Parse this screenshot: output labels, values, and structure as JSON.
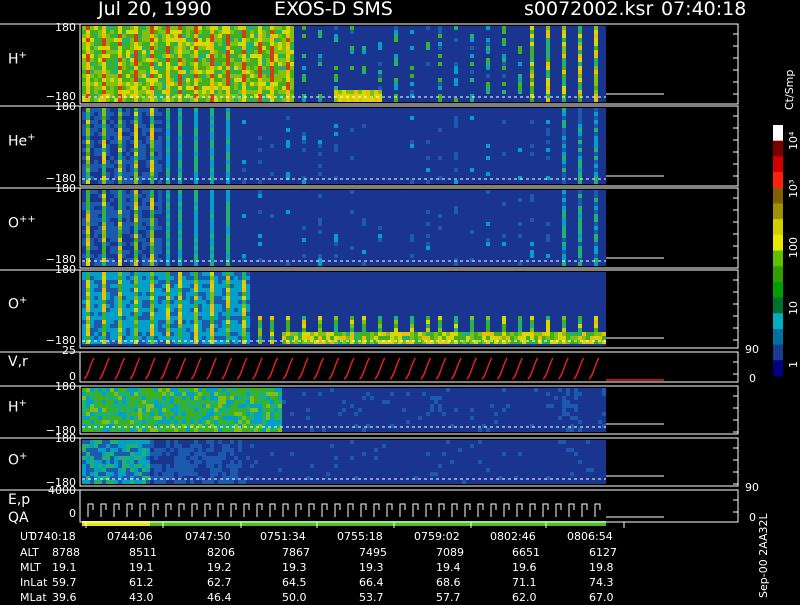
{
  "header": {
    "date": "Jul 20, 1990",
    "instrument": "EXOS-D SMS",
    "file": "s0072002.ksr",
    "time": "07:40:18"
  },
  "panels": [
    {
      "label_base": "H",
      "label_sup": "+",
      "top_tick": "180",
      "bottom_tick": "−180"
    },
    {
      "label_base": "He",
      "label_sup": "+",
      "top_tick": "180",
      "bottom_tick": "−180"
    },
    {
      "label_base": "O",
      "label_sup": "++",
      "top_tick": "180",
      "bottom_tick": "−180"
    },
    {
      "label_base": "O",
      "label_sup": "+",
      "top_tick": "180",
      "bottom_tick": "−180"
    },
    {
      "label_base": "V,r",
      "label_sup": "",
      "top_tick": "25",
      "bottom_tick": "0"
    },
    {
      "label_base": "H",
      "label_sup": "+",
      "top_tick": "180",
      "bottom_tick": "−180"
    },
    {
      "label_base": "O",
      "label_sup": "+",
      "top_tick": "180",
      "bottom_tick": "−180"
    },
    {
      "label_base": "E,p",
      "label_sup": "",
      "top_tick": "4000",
      "bottom_tick": "0"
    }
  ],
  "qa_label": "QA",
  "right_axis": {
    "vr_90": "90",
    "vr_0": "0",
    "ep_90": "90",
    "ep_0": "0",
    "extra_1": "1"
  },
  "colorbar": {
    "unit": "Ct/Smp",
    "labels": [
      "10⁴",
      "10³",
      "100",
      "10",
      "1"
    ],
    "colors": [
      "#ffffff",
      "#7a0000",
      "#d00000",
      "#ff2010",
      "#806000",
      "#a09000",
      "#d0d000",
      "#e8e800",
      "#60c000",
      "#30a000",
      "#00a000",
      "#007030",
      "#00b0c0",
      "#0070a0",
      "#1a3a90",
      "#000080"
    ]
  },
  "ephemeris": {
    "labels": [
      "UT",
      "ALT",
      "MLT",
      "InLat",
      "MLat"
    ],
    "rows": [
      [
        "0740:18",
        "0744:06",
        "0747:50",
        "0751:34",
        "0755:18",
        "0759:02",
        "0802:46",
        "0806:54"
      ],
      [
        "8788",
        "8511",
        "8206",
        "7867",
        "7495",
        "7089",
        "6651",
        "6127"
      ],
      [
        "19.1",
        "19.1",
        "19.2",
        "19.3",
        "19.3",
        "19.4",
        "19.6",
        "19.8"
      ],
      [
        "59.7",
        "61.2",
        "62.7",
        "64.5",
        "66.4",
        "68.6",
        "71.1",
        "74.3"
      ],
      [
        "39.6",
        "43.0",
        "46.4",
        "50.0",
        "53.7",
        "57.7",
        "62.0",
        "67.0"
      ]
    ]
  },
  "footer_vertical": "Sep-00 2AA32L",
  "chart_data": {
    "type": "heatmap",
    "title": "Jul 20, 1990   EXOS-D SMS",
    "xlabel": "UT",
    "x_ticks": [
      "0740:18",
      "0744:06",
      "0747:50",
      "0751:34",
      "0755:18",
      "0759:02",
      "0802:46",
      "0806:54"
    ],
    "panels": [
      {
        "name": "H+",
        "ylim": [
          -180,
          180
        ],
        "description": "pitch angle spectrogram"
      },
      {
        "name": "He+",
        "ylim": [
          -180,
          180
        ]
      },
      {
        "name": "O++",
        "ylim": [
          -180,
          180
        ]
      },
      {
        "name": "O+",
        "ylim": [
          -180,
          180
        ]
      },
      {
        "name": "V,r",
        "ylim": [
          0,
          25
        ]
      },
      {
        "name": "H+",
        "ylim": [
          -180,
          180
        ]
      },
      {
        "name": "O+",
        "ylim": [
          -180,
          180
        ]
      },
      {
        "name": "E,p",
        "ylim": [
          0,
          4000
        ]
      }
    ],
    "colorbar_unit": "Ct/Smp",
    "colorbar_ticks": [
      "1",
      "10",
      "100",
      "10^3",
      "10^4"
    ]
  }
}
